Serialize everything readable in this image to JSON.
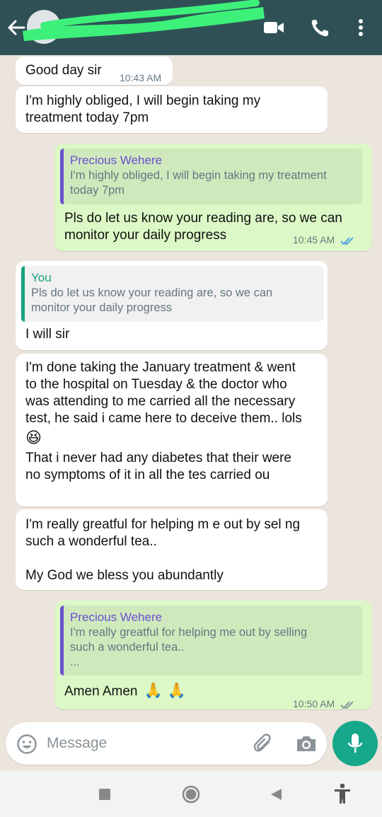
{
  "header": {
    "contact_name": "",
    "icons": [
      "back-arrow-icon",
      "video-call-icon",
      "phone-icon",
      "more-vertical-icon"
    ]
  },
  "colors": {
    "header": "#2f5156",
    "outgoing": "#dcf8c6",
    "incoming": "#ffffff",
    "accent": "#17a88b",
    "read_ticks": "#4fa3e4"
  },
  "messages": [
    {
      "dir": "in",
      "text": "Good day sir",
      "time": "10:43 AM"
    },
    {
      "dir": "in",
      "text": "I'm highly obliged, I will begin taking my\ntreatment today 7pm"
    },
    {
      "dir": "out",
      "quote_author": "Precious Wehere",
      "quote_text": "I'm highly obliged, I will begin taking my treatment\ntoday 7pm",
      "text": "Pls do let us know your reading are, so we can\nmonitor your daily progress",
      "time": "10:45 AM",
      "status": "read"
    },
    {
      "dir": "in",
      "quote_author": "You",
      "quote_text": "Pls do let us know your reading are, so we can\nmonitor your daily progress",
      "text": "I will sir"
    },
    {
      "dir": "in",
      "text": "I'm done taking the January treatment & went\nto the hospital on Tuesday & the doctor who\nwas attending to me carried all the necessary\ntest, he said i came here to deceive them.. lols",
      "emoji": "😆",
      "text2": "That i never had any diabetes that their were\nno symptoms of it in all the tes  carried ou"
    },
    {
      "dir": "in",
      "text": "I'm really greatful for helping m e out by sel  ng\nsuch a wonderful tea..\n\nMy God we bless you abundantly"
    },
    {
      "dir": "out",
      "quote_author": "Precious Wehere",
      "quote_text": "I'm really greatful for helping me out by selling\nsuch a wonderful tea..\n...",
      "text": "Amen Amen",
      "emoji": "🙏 🙏",
      "time": "10:50 AM",
      "status": "delivered"
    }
  ],
  "composer": {
    "placeholder": "Message",
    "value": ""
  },
  "navbar": [
    "recent-apps-icon",
    "home-icon",
    "back-icon",
    "accessibility-icon"
  ]
}
